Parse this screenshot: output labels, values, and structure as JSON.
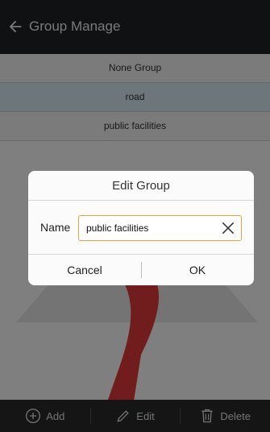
{
  "header": {
    "title": "Group Manage",
    "back_icon": "back-arrow-icon"
  },
  "groups": [
    {
      "label": "None Group",
      "selected": false
    },
    {
      "label": "road",
      "selected": true
    },
    {
      "label": "public facilities",
      "selected": false
    }
  ],
  "toolbar": {
    "add_label": "Add",
    "edit_label": "Edit",
    "delete_label": "Delete"
  },
  "dialog": {
    "title": "Edit Group",
    "name_label": "Name",
    "name_value": "public facilities",
    "cancel_label": "Cancel",
    "ok_label": "OK"
  },
  "colors": {
    "header_bg": "#1f2225",
    "selected_row": "#d8ecf7",
    "input_border": "#e8a23c",
    "toolbar_bg": "#2b2b2b"
  }
}
